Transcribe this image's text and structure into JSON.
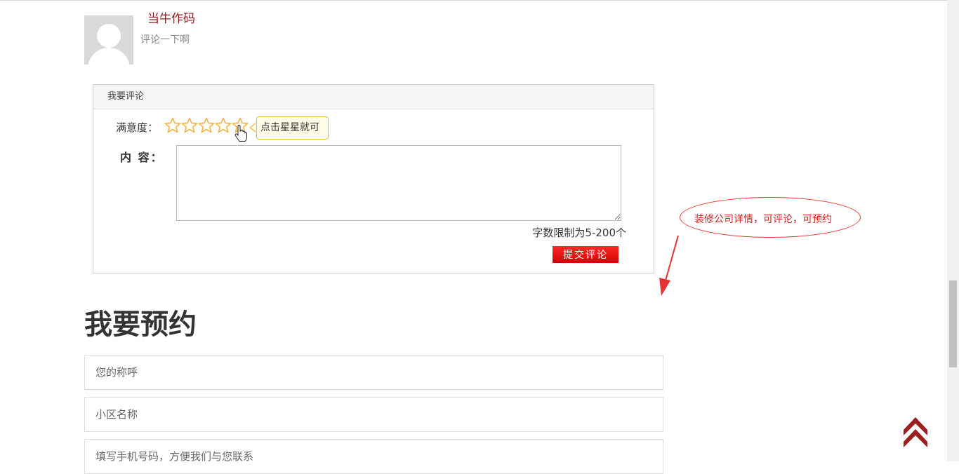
{
  "comment": {
    "author": "当牛作码",
    "text": "评论一下啊"
  },
  "comment_form": {
    "header": "我要评论",
    "satisfaction_label": "满意度：",
    "star_count": 5,
    "rating_tip": "点击星星就可",
    "content_label": "内 容：",
    "content_value": "",
    "char_limit": "字数限制为5-200个",
    "submit_label": "提交评论",
    "submit_color": "#ee1111"
  },
  "annotation": {
    "text": "装修公司详情，可评论，可预约",
    "color": "#e33333"
  },
  "booking": {
    "title": "我要预约",
    "fields": [
      {
        "placeholder": "您的称呼",
        "value": ""
      },
      {
        "placeholder": "小区名称",
        "value": ""
      },
      {
        "placeholder": "填写手机号码，方便我们与您联系",
        "value": ""
      }
    ]
  },
  "icons": {
    "avatar": "default-user-avatar",
    "star": "star-outline-icon",
    "cursor": "hand-pointer-icon",
    "back_to_top": "double-chevron-up-icon"
  },
  "colors": {
    "author": "#8b1e1e",
    "star": "#f0b64a",
    "back_to_top": "#9b1f1f"
  }
}
